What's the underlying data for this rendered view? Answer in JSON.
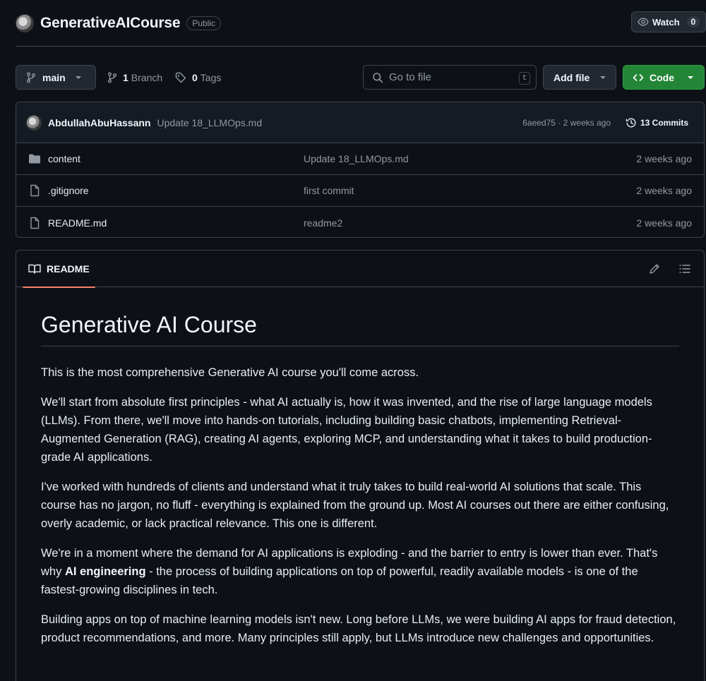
{
  "repo": {
    "name": "GenerativeAICourse",
    "visibility": "Public",
    "watch_label": "Watch",
    "watch_count": "0"
  },
  "toolbar": {
    "branch": "main",
    "branch_count": "1",
    "branch_label": "Branch",
    "tag_count": "0",
    "tag_label": "Tags",
    "goto_placeholder": "Go to file",
    "goto_shortcut": "t",
    "add_file_label": "Add file",
    "code_label": "Code"
  },
  "commit": {
    "author": "AbdullahAbuHassann",
    "message": "Update 18_LLMOps.md",
    "meta": "6aeed75 · 2 weeks ago",
    "commits_label": "13 Commits"
  },
  "files": [
    {
      "name": "content",
      "type": "folder",
      "commit": "Update 18_LLMOps.md",
      "age": "2 weeks ago"
    },
    {
      "name": ".gitignore",
      "type": "file",
      "commit": "first commit",
      "age": "2 weeks ago"
    },
    {
      "name": "README.md",
      "type": "file",
      "commit": "readme2",
      "age": "2 weeks ago"
    }
  ],
  "readme": {
    "tab_label": "README",
    "title": "Generative AI Course",
    "p1": "This is the most comprehensive Generative AI course you'll come across.",
    "p2": "We'll start from absolute first principles - what AI actually is, how it was invented, and the rise of large language models (LLMs). From there, we'll move into hands-on tutorials, including building basic chatbots, implementing Retrieval-Augmented Generation (RAG), creating AI agents, exploring MCP, and understanding what it takes to build production-grade AI applications.",
    "p3": "I've worked with hundreds of clients and understand what it truly takes to build real-world AI solutions that scale. This course has no jargon, no fluff - everything is explained from the ground up. Most AI courses out there are either confusing, overly academic, or lack practical relevance. This one is different.",
    "p4_before": "We're in a moment where the demand for AI applications is exploding - and the barrier to entry is lower than ever. That's why ",
    "p4_bold": "AI engineering",
    "p4_after": " - the process of building applications on top of powerful, readily available models - is one of the fastest-growing disciplines in tech.",
    "p5": "Building apps on top of machine learning models isn't new. Long before LLMs, we were building AI apps for fraud detection, product recommendations, and more. Many principles still apply, but LLMs introduce new challenges and opportunities."
  },
  "colors": {
    "background": "#0d1117",
    "border": "#3d444d",
    "accent_green": "#238636",
    "tab_underline": "#f78166",
    "muted_text": "#9198a1"
  }
}
